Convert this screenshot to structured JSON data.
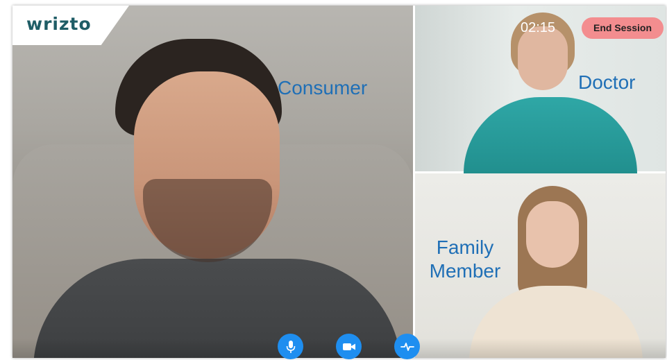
{
  "app": {
    "logo": "wrizto"
  },
  "session": {
    "timer": "02:15",
    "end_label": "End Session"
  },
  "participants": {
    "consumer": {
      "label": "Consumer"
    },
    "doctor": {
      "label": "Doctor"
    },
    "family": {
      "label_line1": "Family",
      "label_line2": "Member"
    }
  },
  "controls": [
    {
      "icon": "microphone-icon"
    },
    {
      "icon": "video-camera-icon"
    },
    {
      "icon": "vitals-pulse-icon"
    }
  ],
  "colors": {
    "accent_blue": "#1e8ef0",
    "label_blue": "#1f6fb6",
    "end_button": "#f38d8f",
    "logo": "#1f5d66"
  }
}
